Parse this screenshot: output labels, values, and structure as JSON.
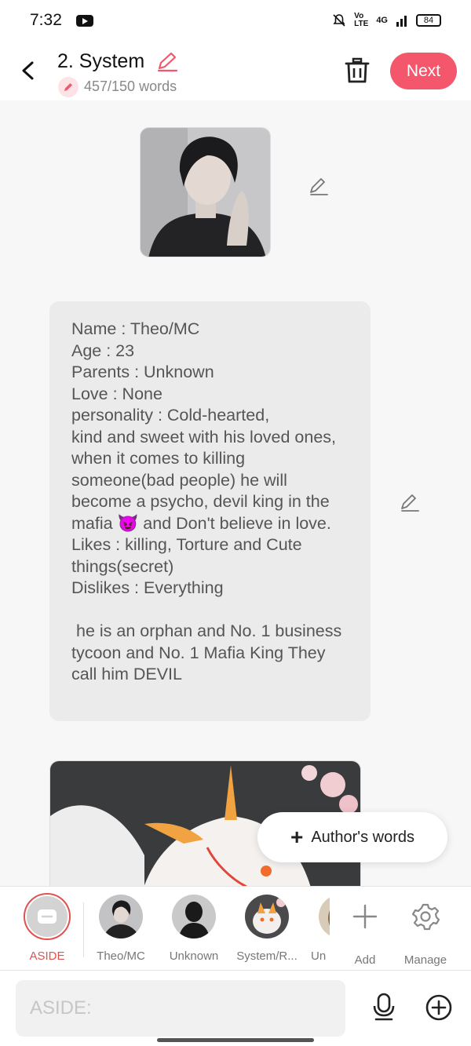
{
  "status_bar": {
    "time": "7:32",
    "network": "4G",
    "battery": "84"
  },
  "header": {
    "title": "2. System",
    "word_count": "457/150 words",
    "next_label": "Next"
  },
  "content": {
    "character_text": "Name : Theo/MC\nAge : 23\nParents : Unknown\nLove : None\npersonality : Cold-hearted,\nkind and sweet with his loved ones, when it comes to killing someone(bad people) he will become a psycho, devil king in the mafia 😈 and Don't believe in love.\nLikes : killing, Torture and Cute things(secret)\nDislikes : Everything\n\n he is an orphan and No. 1 business tycoon and No. 1 Mafia King They call him DEVIL"
  },
  "floating_button": {
    "label": "Author's words"
  },
  "characters": [
    {
      "label": "ASIDE",
      "active": true
    },
    {
      "label": "Theo/MC"
    },
    {
      "label": "Unknown"
    },
    {
      "label": "System/R..."
    },
    {
      "label": "Un"
    }
  ],
  "actions": {
    "add_label": "Add",
    "manage_label": "Manage"
  },
  "input": {
    "placeholder": "ASIDE:"
  },
  "colors": {
    "accent": "#f4566b",
    "active_label": "#e2504f"
  }
}
